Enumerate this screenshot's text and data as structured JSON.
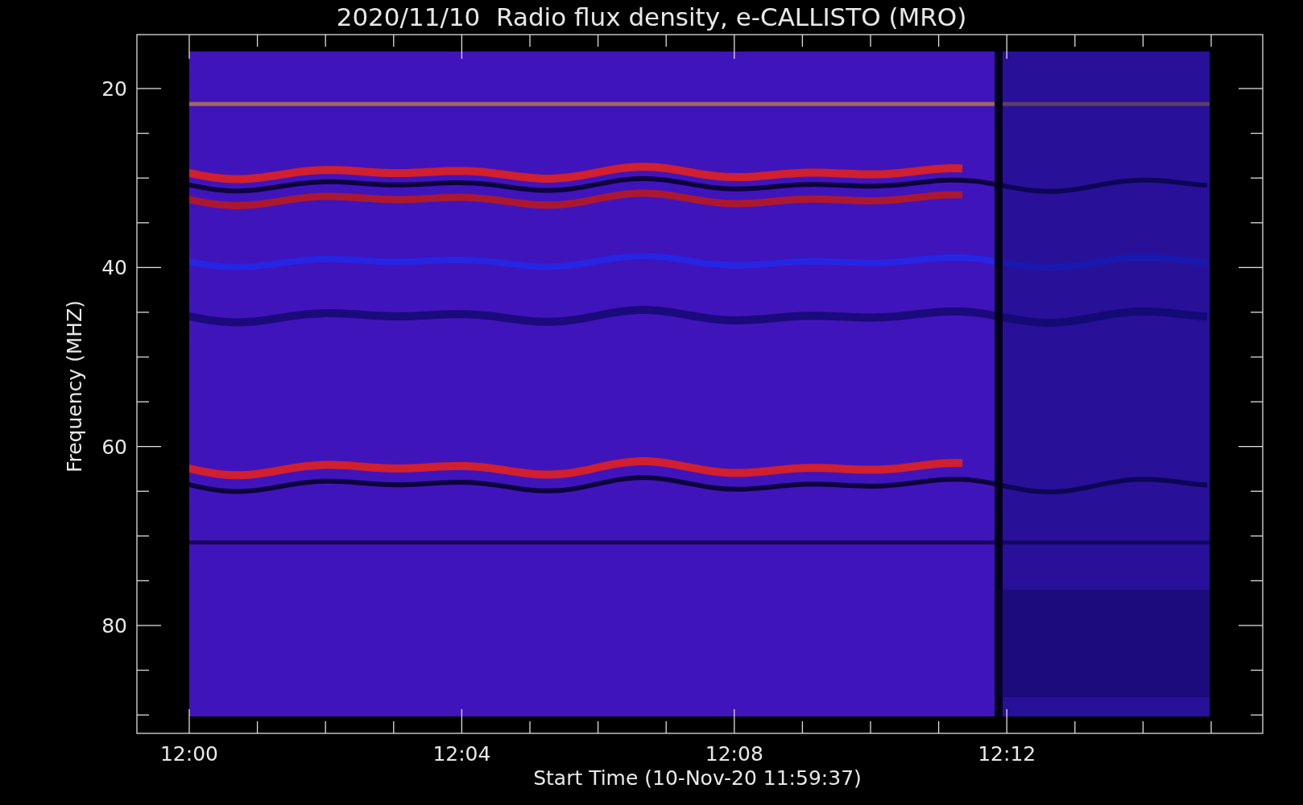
{
  "title": "2020/11/10  Radio flux density, e-CALLISTO (MRO)",
  "y_axis": {
    "label": "Frequency (MHZ)",
    "tick_labels": [
      "20",
      "40",
      "60",
      "80"
    ]
  },
  "x_axis": {
    "label": "Start Time (10-Nov-20 11:59:37)",
    "tick_labels": [
      "12:00",
      "12:04",
      "12:08",
      "12:12"
    ]
  }
}
